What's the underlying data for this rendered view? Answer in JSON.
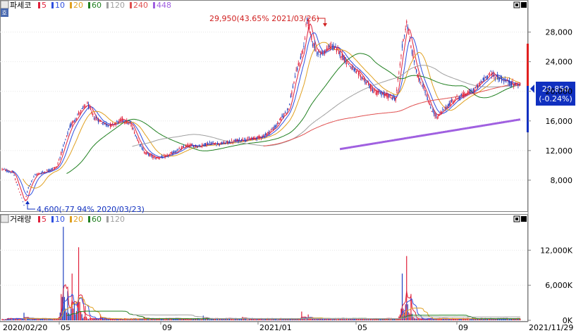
{
  "price_panel": {
    "title": "파세코",
    "ma_legend": [
      {
        "label": "5",
        "color": "#e0203a"
      },
      {
        "label": "10",
        "color": "#3050e0"
      },
      {
        "label": "20",
        "color": "#e0a020"
      },
      {
        "label": "60",
        "color": "#208020"
      },
      {
        "label": "120",
        "color": "#a0a0a0"
      },
      {
        "label": "240",
        "color": "#e05050"
      },
      {
        "label": "448",
        "color": "#a060e0"
      }
    ],
    "high_label": "29,950(43.65% 2021/03/26)",
    "low_label": "4,600(-77.94% 2020/03/23)",
    "current_price": "20,850",
    "current_change": "(-0.24%)",
    "y_ticks": [
      "28,000",
      "24,000",
      "20,000",
      "16,000",
      "12,000",
      "8,000"
    ],
    "corner_button_icons": [
      "restore-icon",
      "close-icon"
    ]
  },
  "volume_panel": {
    "title": "거래량",
    "ma_legend": [
      {
        "label": "5",
        "color": "#e0203a"
      },
      {
        "label": "10",
        "color": "#3050e0"
      },
      {
        "label": "20",
        "color": "#e0a020"
      },
      {
        "label": "60",
        "color": "#208020"
      },
      {
        "label": "120",
        "color": "#a0a0a0"
      }
    ],
    "y_ticks": [
      "12,000K",
      "6,000K",
      "0K"
    ]
  },
  "x_axis": {
    "labels": [
      "2020/02/20",
      "05",
      "09",
      "2021/01",
      "05",
      "09",
      "2021/11/29"
    ]
  },
  "colors": {
    "up": "#e0203a",
    "down": "#2040c0",
    "price_axis_red": "#e02020",
    "price_axis_blue": "#1030c0",
    "current_box": "#1030c0"
  },
  "chart_data": {
    "type": "candlestick",
    "series": [
      {
        "name": "파세코",
        "anchors": [
          [
            0,
            9500
          ],
          [
            10,
            9000
          ],
          [
            18,
            5600
          ],
          [
            20,
            4600
          ],
          [
            24,
            7000
          ],
          [
            30,
            8700
          ],
          [
            40,
            9200
          ],
          [
            50,
            9800
          ],
          [
            56,
            12500
          ],
          [
            62,
            15200
          ],
          [
            70,
            17000
          ],
          [
            78,
            18300
          ],
          [
            84,
            16500
          ],
          [
            92,
            15700
          ],
          [
            100,
            15400
          ],
          [
            110,
            16200
          ],
          [
            118,
            15500
          ],
          [
            124,
            13500
          ],
          [
            130,
            11800
          ],
          [
            140,
            11000
          ],
          [
            150,
            11200
          ],
          [
            160,
            12000
          ],
          [
            170,
            12700
          ],
          [
            180,
            12600
          ],
          [
            190,
            13000
          ],
          [
            200,
            12900
          ],
          [
            210,
            13200
          ],
          [
            220,
            13500
          ],
          [
            230,
            13600
          ],
          [
            240,
            14000
          ],
          [
            250,
            15200
          ],
          [
            256,
            16500
          ],
          [
            262,
            17700
          ],
          [
            268,
            22000
          ],
          [
            272,
            24000
          ],
          [
            276,
            26000
          ],
          [
            279,
            29950
          ],
          [
            284,
            26500
          ],
          [
            290,
            25000
          ],
          [
            296,
            25500
          ],
          [
            302,
            26200
          ],
          [
            310,
            25000
          ],
          [
            318,
            23500
          ],
          [
            324,
            22500
          ],
          [
            330,
            21800
          ],
          [
            340,
            20000
          ],
          [
            350,
            19500
          ],
          [
            360,
            19000
          ],
          [
            366,
            26000
          ],
          [
            370,
            29500
          ],
          [
            374,
            26000
          ],
          [
            380,
            22000
          ],
          [
            386,
            20500
          ],
          [
            392,
            17700
          ],
          [
            398,
            16500
          ],
          [
            404,
            17500
          ],
          [
            414,
            19000
          ],
          [
            424,
            19600
          ],
          [
            432,
            20200
          ],
          [
            440,
            21500
          ],
          [
            446,
            22500
          ],
          [
            454,
            21800
          ],
          [
            462,
            21300
          ],
          [
            470,
            20900
          ],
          [
            474,
            20850
          ]
        ]
      },
      {
        "name": "거래량",
        "peaks": [
          [
            20,
            1300
          ],
          [
            54,
            4500
          ],
          [
            56,
            16000
          ],
          [
            60,
            5000
          ],
          [
            64,
            8000
          ],
          [
            66,
            3000
          ],
          [
            70,
            12500
          ],
          [
            76,
            2500
          ],
          [
            90,
            1000
          ],
          [
            130,
            600
          ],
          [
            184,
            800
          ],
          [
            220,
            600
          ],
          [
            274,
            1500
          ],
          [
            280,
            1000
          ],
          [
            366,
            8000
          ],
          [
            370,
            11000
          ],
          [
            374,
            4500
          ]
        ]
      }
    ],
    "y_range": [
      4000,
      31000
    ],
    "volume_range": [
      0,
      16500
    ]
  }
}
